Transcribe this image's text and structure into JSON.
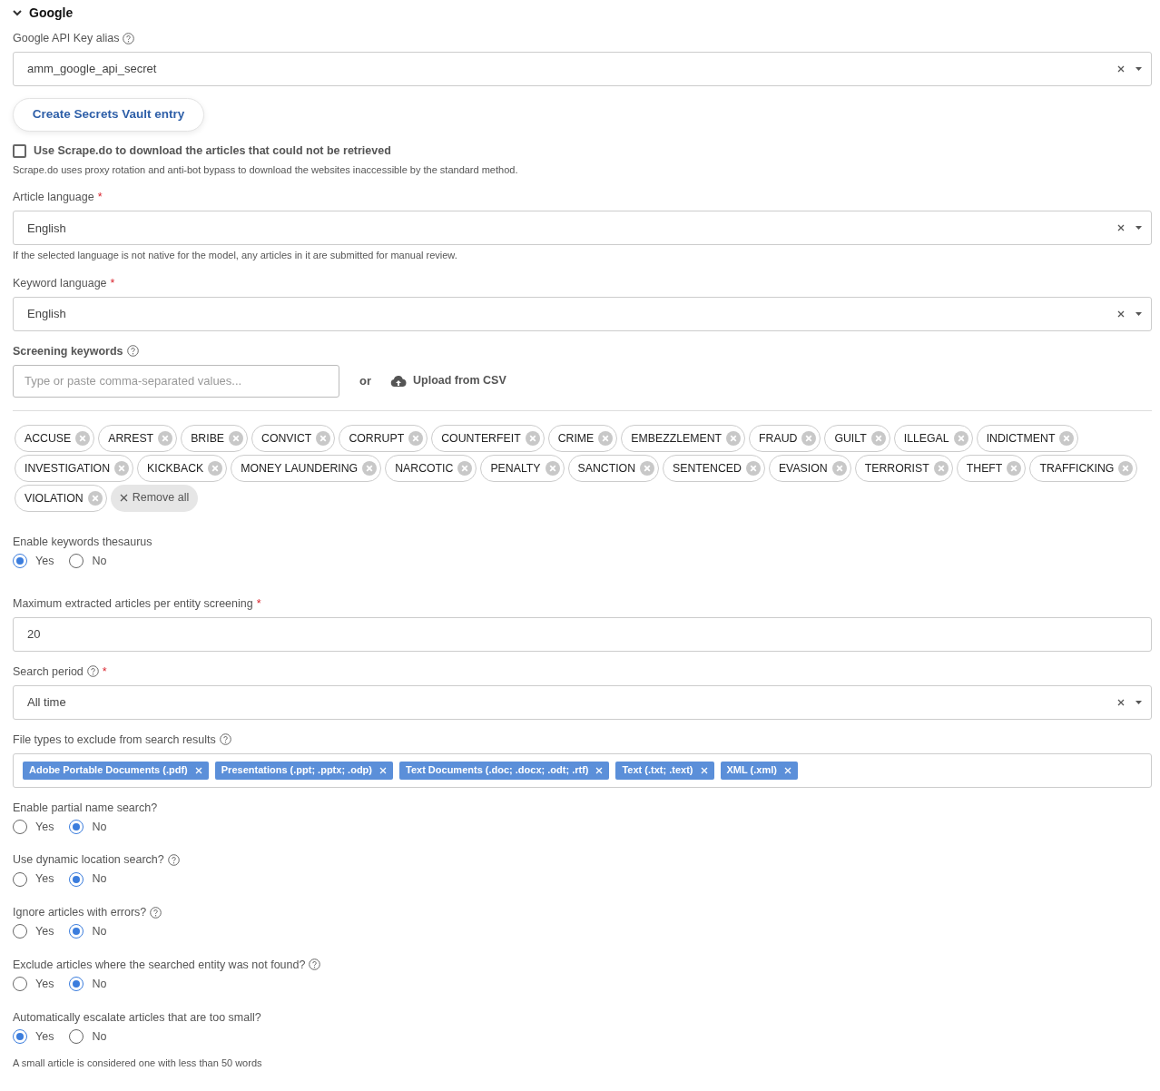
{
  "section": {
    "title": "Google",
    "expanded": true
  },
  "fields": [
    {
      "kind": "select",
      "label": "Google API Key alias",
      "help": true,
      "value": "amm_google_api_secret"
    },
    {
      "kind": "button",
      "label": "Create Secrets Vault entry"
    },
    {
      "kind": "checkbox",
      "label": "Use Scrape.do to download the articles that could not be retrieved",
      "checked": false,
      "hint": "Scrape.do uses proxy rotation and anti-bot bypass to download the websites inaccessible by the standard method."
    },
    {
      "kind": "select",
      "label": "Article language",
      "required_mark": "*",
      "value": "English",
      "hint": "If the selected language is not native for the model, any articles in it are submitted for manual review."
    },
    {
      "kind": "select",
      "label": "Keyword language",
      "required_mark": "*",
      "value": "English"
    },
    {
      "kind": "keywords",
      "label": "Screening keywords",
      "help": true,
      "placeholder": "Type or paste comma-separated values...",
      "separator": "or",
      "upload": "Upload from CSV",
      "remove_all": "Remove all",
      "chips": [
        "ACCUSE",
        "ARREST",
        "BRIBE",
        "CONVICT",
        "CORRUPT",
        "COUNTERFEIT",
        "CRIME",
        "EMBEZZLEMENT",
        "FRAUD",
        "GUILT",
        "ILLEGAL",
        "INDICTMENT",
        "INVESTIGATION",
        "KICKBACK",
        "MONEY LAUNDERING",
        "NARCOTIC",
        "PENALTY",
        "SANCTION",
        "SENTENCED",
        "EVASION",
        "TERRORIST",
        "THEFT",
        "TRAFFICKING",
        "VIOLATION"
      ]
    },
    {
      "kind": "radio",
      "label": "Enable keywords thesaurus",
      "options": [
        {
          "label": "Yes",
          "selected": true
        },
        {
          "label": "No",
          "selected": false
        }
      ]
    },
    {
      "kind": "text",
      "label": "Maximum extracted articles per entity screening",
      "required_mark": "*",
      "value": "20"
    },
    {
      "kind": "select",
      "label": "Search period",
      "help": true,
      "required_mark": "*",
      "value": "All time"
    },
    {
      "kind": "tags",
      "label": "File types to exclude from search results",
      "help": true,
      "tags": [
        "Adobe Portable Documents (.pdf)",
        "Presentations (.ppt; .pptx; .odp)",
        "Text Documents (.doc; .docx; .odt; .rtf)",
        "Text (.txt; .text)",
        "XML (.xml)"
      ]
    },
    {
      "kind": "radio",
      "label": "Enable partial name search?",
      "options": [
        {
          "label": "Yes",
          "selected": false
        },
        {
          "label": "No",
          "selected": true
        }
      ]
    },
    {
      "kind": "radio",
      "label": "Use dynamic location search?",
      "help": true,
      "options": [
        {
          "label": "Yes",
          "selected": false
        },
        {
          "label": "No",
          "selected": true
        }
      ]
    },
    {
      "kind": "radio",
      "label": "Ignore articles with errors?",
      "help": true,
      "options": [
        {
          "label": "Yes",
          "selected": false
        },
        {
          "label": "No",
          "selected": true
        }
      ]
    },
    {
      "kind": "radio",
      "label": "Exclude articles where the searched entity was not found?",
      "help": true,
      "options": [
        {
          "label": "Yes",
          "selected": false
        },
        {
          "label": "No",
          "selected": true
        }
      ]
    },
    {
      "kind": "radio",
      "label": "Automatically escalate articles that are too small?",
      "options": [
        {
          "label": "Yes",
          "selected": true
        },
        {
          "label": "No",
          "selected": false
        }
      ],
      "hint": "A small article is considered one with less than 50 words"
    }
  ]
}
